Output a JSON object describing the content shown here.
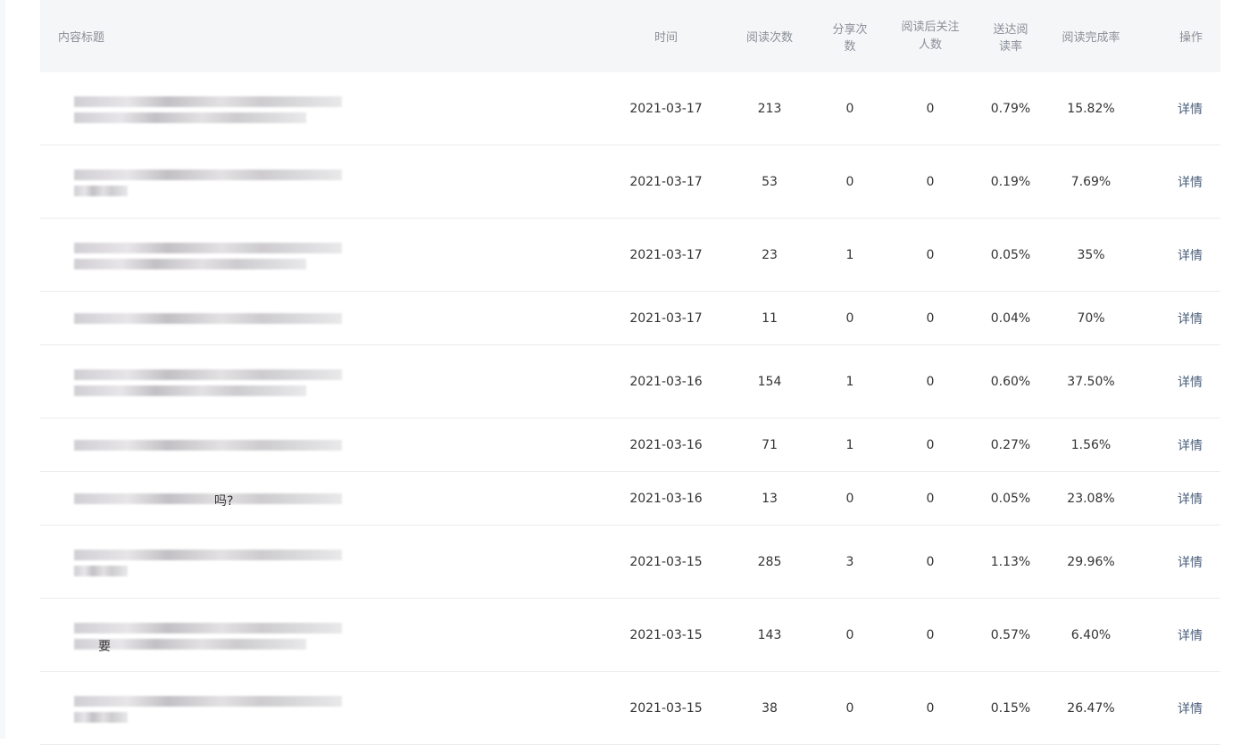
{
  "header": {
    "title": "内容标题",
    "time": "时间",
    "reads": "阅读次数",
    "shares": "分享次数",
    "followers_line1": "阅读后关注",
    "followers_line2": "人数",
    "delivery_rate": "送达阅读率",
    "completion_rate": "阅读完成率",
    "actions": "操作"
  },
  "rows": [
    {
      "date": "2021-03-17",
      "reads": "213",
      "shares": "0",
      "followers": "0",
      "delivery": "0.79%",
      "completion": "15.82%",
      "action": "详情"
    },
    {
      "date": "2021-03-17",
      "reads": "53",
      "shares": "0",
      "followers": "0",
      "delivery": "0.19%",
      "completion": "7.69%",
      "action": "详情"
    },
    {
      "date": "2021-03-17",
      "reads": "23",
      "shares": "1",
      "followers": "0",
      "delivery": "0.05%",
      "completion": "35%",
      "action": "详情"
    },
    {
      "date": "2021-03-17",
      "reads": "11",
      "shares": "0",
      "followers": "0",
      "delivery": "0.04%",
      "completion": "70%",
      "action": "详情"
    },
    {
      "date": "2021-03-16",
      "reads": "154",
      "shares": "1",
      "followers": "0",
      "delivery": "0.60%",
      "completion": "37.50%",
      "action": "详情"
    },
    {
      "date": "2021-03-16",
      "reads": "71",
      "shares": "1",
      "followers": "0",
      "delivery": "0.27%",
      "completion": "1.56%",
      "action": "详情"
    },
    {
      "date": "2021-03-16",
      "reads": "13",
      "shares": "0",
      "followers": "0",
      "delivery": "0.05%",
      "completion": "23.08%",
      "action": "详情",
      "title_visible": "吗?"
    },
    {
      "date": "2021-03-15",
      "reads": "285",
      "shares": "3",
      "followers": "0",
      "delivery": "1.13%",
      "completion": "29.96%",
      "action": "详情"
    },
    {
      "date": "2021-03-15",
      "reads": "143",
      "shares": "0",
      "followers": "0",
      "delivery": "0.57%",
      "completion": "6.40%",
      "action": "详情",
      "title_visible": "要"
    },
    {
      "date": "2021-03-15",
      "reads": "38",
      "shares": "0",
      "followers": "0",
      "delivery": "0.15%",
      "completion": "26.47%",
      "action": "详情"
    }
  ]
}
